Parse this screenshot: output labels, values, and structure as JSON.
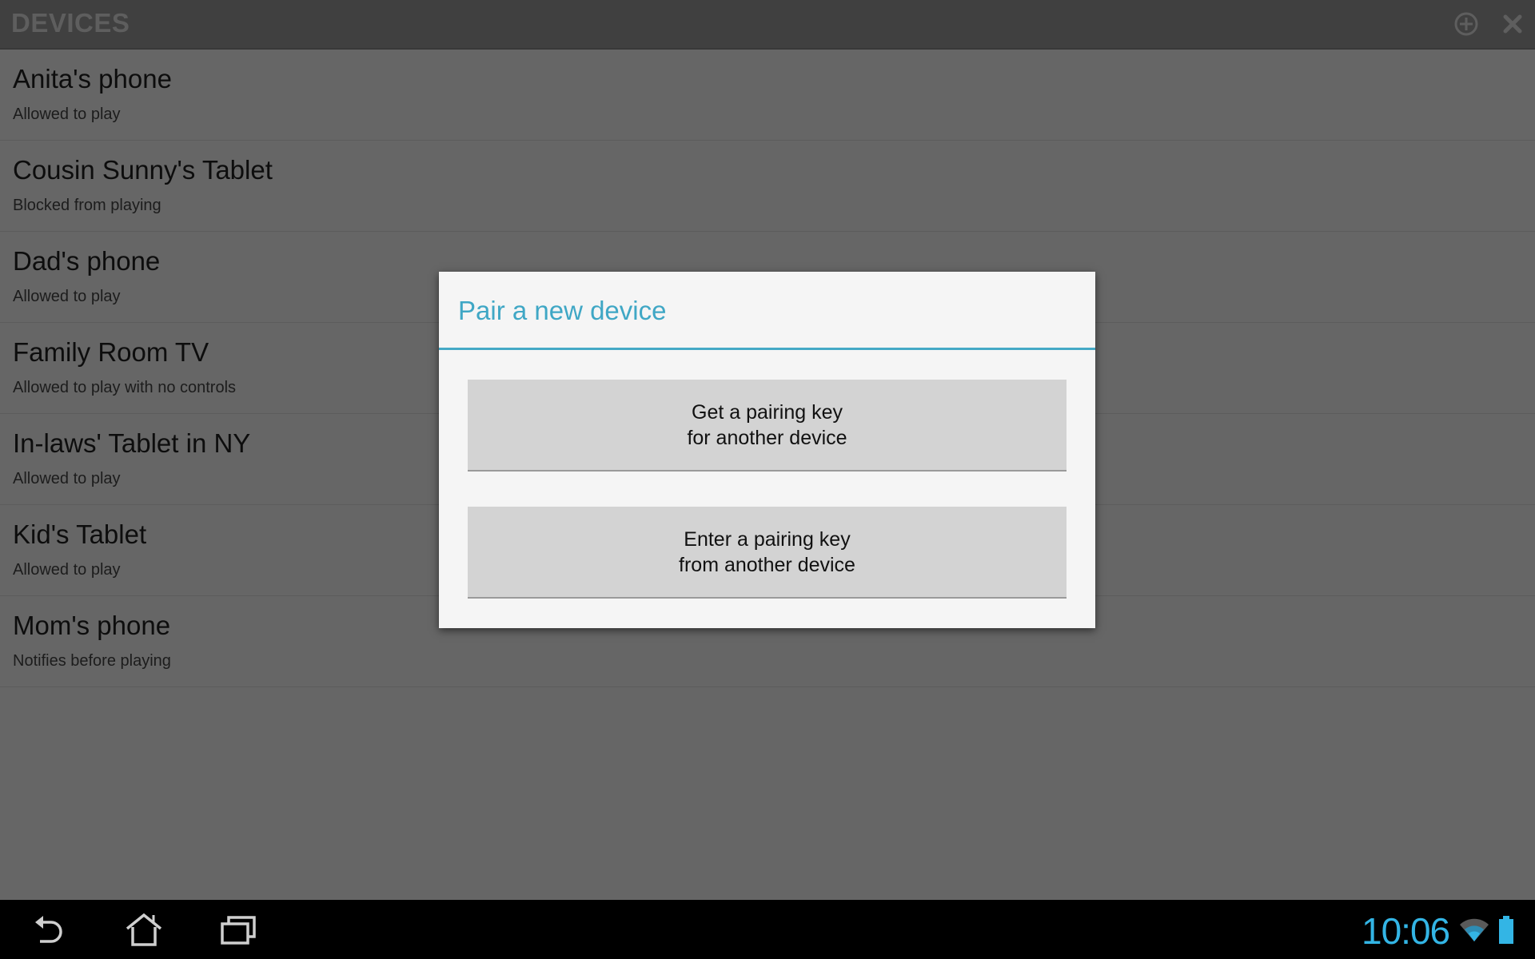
{
  "action_bar": {
    "title": "DEVICES",
    "actions": [
      {
        "name": "add",
        "icon": "add-circle-icon"
      },
      {
        "name": "close",
        "icon": "close-icon"
      }
    ]
  },
  "devices": [
    {
      "name": "Anita's phone",
      "status": "Allowed to play"
    },
    {
      "name": "Cousin Sunny's Tablet",
      "status": "Blocked from playing"
    },
    {
      "name": "Dad's phone",
      "status": "Allowed to play"
    },
    {
      "name": "Family Room TV",
      "status": "Allowed to play with no controls"
    },
    {
      "name": "In-laws' Tablet in NY",
      "status": "Allowed to play"
    },
    {
      "name": "Kid's Tablet",
      "status": "Allowed to play"
    },
    {
      "name": "Mom's phone",
      "status": "Notifies before playing"
    }
  ],
  "dialog": {
    "title": "Pair a new device",
    "buttons": [
      {
        "line1": "Get a pairing key",
        "line2": "for another device"
      },
      {
        "line1": "Enter a pairing key",
        "line2": "from another device"
      }
    ]
  },
  "nav_bar": {
    "buttons": [
      "back-icon",
      "home-icon",
      "recent-apps-icon"
    ]
  },
  "status_bar": {
    "time": "10:06",
    "wifi": "wifi-icon",
    "battery": "battery-icon"
  },
  "colors": {
    "accent": "#33b5e5",
    "dialog_title": "#3fa7c5",
    "scrim_background": "#666666"
  }
}
